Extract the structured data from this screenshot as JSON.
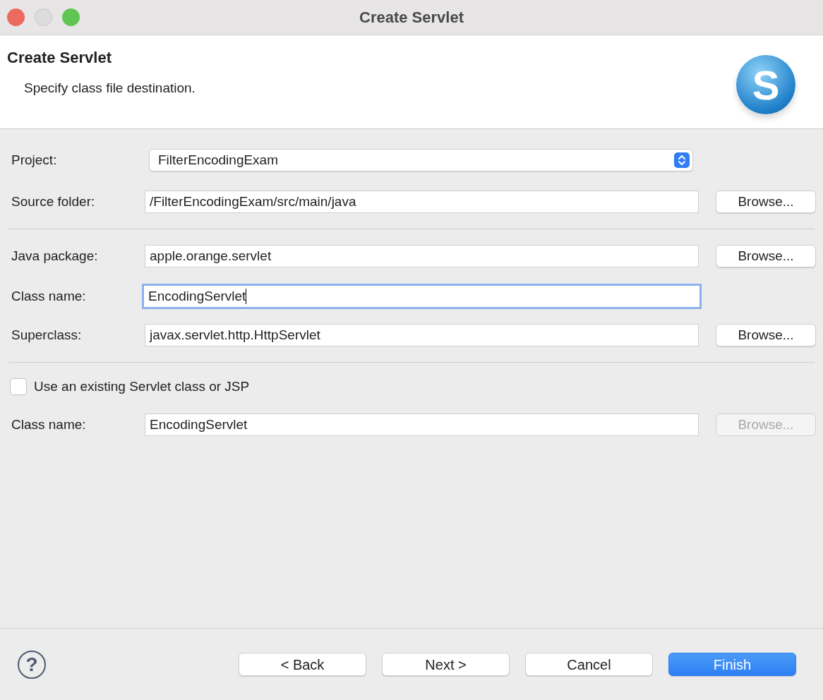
{
  "window": {
    "title": "Create Servlet"
  },
  "header": {
    "title": "Create Servlet",
    "description": "Specify class file destination.",
    "logo_text": "S"
  },
  "sections": [
    [
      {
        "kind": "select",
        "label": "Project:",
        "value": "FilterEncodingExam"
      },
      {
        "kind": "text",
        "label": "Source folder:",
        "value": "/FilterEncodingExam/src/main/java",
        "focused": false,
        "browse": {
          "label": "Browse...",
          "disabled": false
        }
      }
    ],
    [
      {
        "kind": "text",
        "label": "Java package:",
        "value": "apple.orange.servlet",
        "focused": false,
        "browse": {
          "label": "Browse...",
          "disabled": false
        }
      },
      {
        "kind": "text",
        "label": "Class name:",
        "value": "EncodingServlet",
        "focused": true
      },
      {
        "kind": "text",
        "label": "Superclass:",
        "value": "javax.servlet.http.HttpServlet",
        "focused": false,
        "browse": {
          "label": "Browse...",
          "disabled": false
        }
      }
    ],
    [
      {
        "kind": "checkbox",
        "label": "Use an existing Servlet class or JSP",
        "checked": false
      },
      {
        "kind": "text",
        "label": "Class name:",
        "value": "EncodingServlet",
        "focused": false,
        "browse": {
          "label": "Browse...",
          "disabled": true
        }
      }
    ]
  ],
  "help": "?",
  "buttons": [
    {
      "label": "< Back",
      "primary": false
    },
    {
      "label": "Next >",
      "primary": false
    },
    {
      "label": "Cancel",
      "primary": false
    },
    {
      "label": "Finish",
      "primary": true
    }
  ]
}
